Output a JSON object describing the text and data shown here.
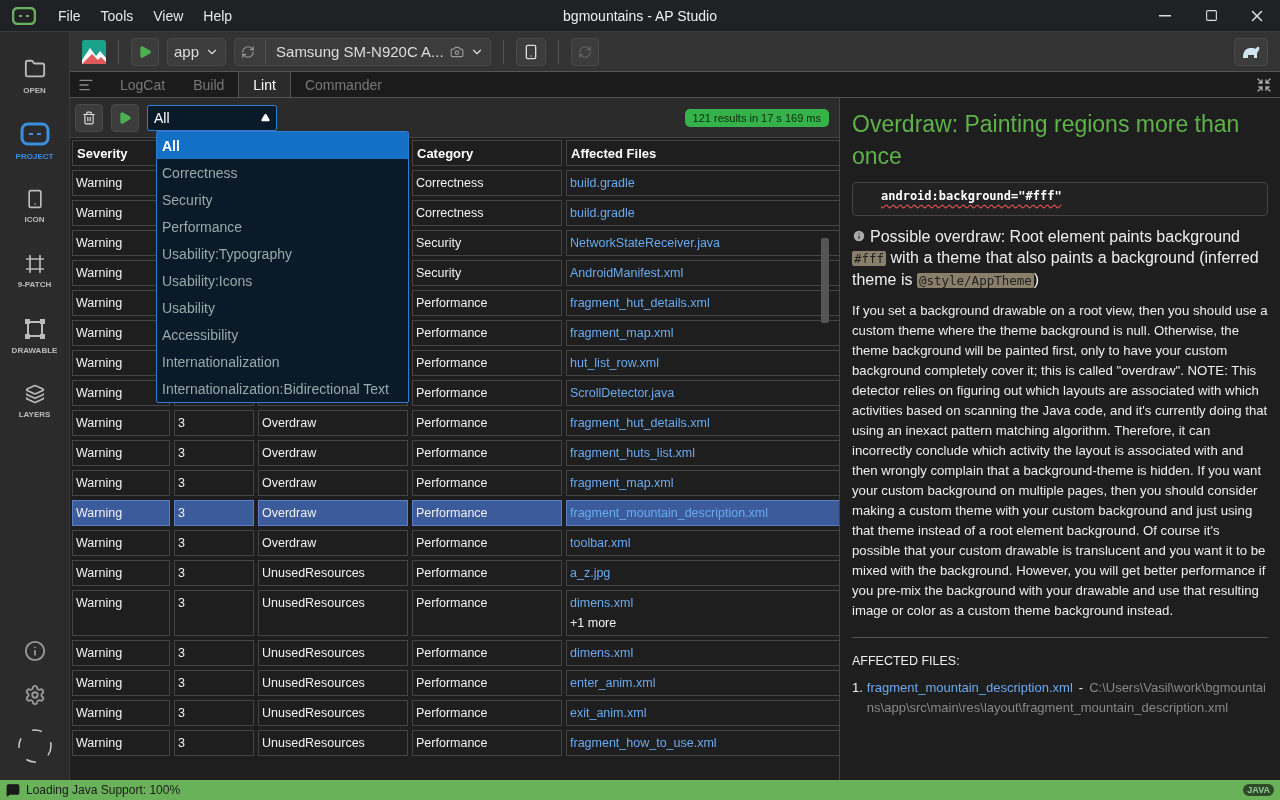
{
  "window": {
    "title": "bgmountains - AP Studio"
  },
  "menu": [
    "File",
    "Tools",
    "View",
    "Help"
  ],
  "sidebar": {
    "items": [
      {
        "label": "OPEN",
        "kind": "folder",
        "selected": false
      },
      {
        "label": "PROJECT",
        "kind": "project",
        "selected": true
      },
      {
        "label": "ICON",
        "kind": "android",
        "selected": false
      },
      {
        "label": "9-PATCH",
        "kind": "patch",
        "selected": false
      },
      {
        "label": "DRAWABLE",
        "kind": "drawable",
        "selected": false
      },
      {
        "label": "LAYERS",
        "kind": "layers",
        "selected": false
      }
    ]
  },
  "toolbar": {
    "module": "app",
    "device": "Samsung SM-N920C A..."
  },
  "tabs": [
    {
      "label": "LogCat",
      "selected": false
    },
    {
      "label": "Build",
      "selected": false
    },
    {
      "label": "Lint",
      "selected": true
    },
    {
      "label": "Commander",
      "selected": false
    }
  ],
  "filter": {
    "value": "All",
    "expanded": true,
    "options": [
      {
        "label": "All",
        "selected": true
      },
      {
        "label": "Correctness",
        "selected": false
      },
      {
        "label": "Security",
        "selected": false
      },
      {
        "label": "Performance",
        "selected": false
      },
      {
        "label": "Usability:Typography",
        "selected": false
      },
      {
        "label": "Usability:Icons",
        "selected": false
      },
      {
        "label": "Usability",
        "selected": false
      },
      {
        "label": "Accessibility",
        "selected": false
      },
      {
        "label": "Internationalization",
        "selected": false
      },
      {
        "label": "Internationalization:Bidirectional Text",
        "selected": false
      }
    ]
  },
  "results_badge": "121 results in 17 s 169 ms",
  "table": {
    "columns": [
      "Severity",
      "",
      "",
      "Category",
      "Affected Files"
    ],
    "rows": [
      {
        "severity": "Warning",
        "category": "Correctness",
        "files": [
          "build.gradle"
        ],
        "selected": false
      },
      {
        "severity": "Warning",
        "category": "Correctness",
        "files": [
          "build.gradle"
        ],
        "selected": false
      },
      {
        "severity": "Warning",
        "category": "Security",
        "files": [
          "NetworkStateReceiver.java"
        ],
        "selected": false
      },
      {
        "severity": "Warning",
        "category": "Security",
        "files": [
          "AndroidManifest.xml"
        ],
        "selected": false
      },
      {
        "severity": "Warning",
        "category": "Performance",
        "files": [
          "fragment_hut_details.xml"
        ],
        "selected": false
      },
      {
        "severity": "Warning",
        "category": "Performance",
        "files": [
          "fragment_map.xml"
        ],
        "selected": false
      },
      {
        "severity": "Warning",
        "category": "Performance",
        "files": [
          "hut_list_row.xml"
        ],
        "selected": false
      },
      {
        "severity": "Warning",
        "category": "Performance",
        "files": [
          "ScrollDetector.java"
        ],
        "selected": false
      },
      {
        "severity": "Warning",
        "priority": "3",
        "issue": "Overdraw",
        "category": "Performance",
        "files": [
          "fragment_hut_details.xml"
        ],
        "selected": false
      },
      {
        "severity": "Warning",
        "priority": "3",
        "issue": "Overdraw",
        "category": "Performance",
        "files": [
          "fragment_huts_list.xml"
        ],
        "selected": false
      },
      {
        "severity": "Warning",
        "priority": "3",
        "issue": "Overdraw",
        "category": "Performance",
        "files": [
          "fragment_map.xml"
        ],
        "selected": false
      },
      {
        "severity": "Warning",
        "priority": "3",
        "issue": "Overdraw",
        "category": "Performance",
        "files": [
          "fragment_mountain_description.xml"
        ],
        "selected": true
      },
      {
        "severity": "Warning",
        "priority": "3",
        "issue": "Overdraw",
        "category": "Performance",
        "files": [
          "toolbar.xml"
        ],
        "selected": false
      },
      {
        "severity": "Warning",
        "priority": "3",
        "issue": "UnusedResources",
        "category": "Performance",
        "files": [
          "a_z.jpg"
        ],
        "selected": false
      },
      {
        "severity": "Warning",
        "priority": "3",
        "issue": "UnusedResources",
        "category": "Performance",
        "files": [
          "dimens.xml"
        ],
        "more": "+1 more",
        "selected": false
      },
      {
        "severity": "Warning",
        "priority": "3",
        "issue": "UnusedResources",
        "category": "Performance",
        "files": [
          "dimens.xml"
        ],
        "selected": false
      },
      {
        "severity": "Warning",
        "priority": "3",
        "issue": "UnusedResources",
        "category": "Performance",
        "files": [
          "enter_anim.xml"
        ],
        "selected": false
      },
      {
        "severity": "Warning",
        "priority": "3",
        "issue": "UnusedResources",
        "category": "Performance",
        "files": [
          "exit_anim.xml"
        ],
        "selected": false
      },
      {
        "severity": "Warning",
        "priority": "3",
        "issue": "UnusedResources",
        "category": "Performance",
        "files": [
          "fragment_how_to_use.xml"
        ],
        "selected": false
      }
    ]
  },
  "detail": {
    "title": "Overdraw: Painting regions more than once",
    "code": "android:background=\"#fff\"",
    "summary": [
      {
        "kind": "text",
        "text": "Possible overdraw: Root element paints background "
      },
      {
        "kind": "code",
        "text": "#fff"
      },
      {
        "kind": "text",
        "text": " with a theme that also paints a background (inferred theme is "
      },
      {
        "kind": "code",
        "text": "@style/AppTheme"
      },
      {
        "kind": "text",
        "text": ")"
      }
    ],
    "explanation": "If you set a background drawable on a root view, then you should use a custom theme where the theme background is null. Otherwise, the theme background will be painted first, only to have your custom background completely cover it; this is called \"overdraw\". NOTE: This detector relies on figuring out which layouts are associated with which activities based on scanning the Java code, and it's currently doing that using an inexact pattern matching algorithm. Therefore, it can incorrectly conclude which activity the layout is associated with and then wrongly complain that a background-theme is hidden. If you want your custom background on multiple pages, then you should consider making a custom theme with your custom background and just using that theme instead of a root element background. Of course it's possible that your custom drawable is translucent and you want it to be mixed with the background. However, you will get better performance if you pre-mix the background with your drawable and use that resulting image or color as a custom theme background instead.",
    "affected_heading": "AFFECTED FILES:",
    "affected": [
      {
        "number": "1.",
        "file": "fragment_mountain_description.xml",
        "separator": "-",
        "path": "C:\\Users\\Vasil\\work\\bgmountains\\app\\src\\main\\res\\layout\\fragment_mountain_description.xml"
      }
    ]
  },
  "status_bar": {
    "message": "Loading Java Support: 100%",
    "language": "JAVA"
  }
}
